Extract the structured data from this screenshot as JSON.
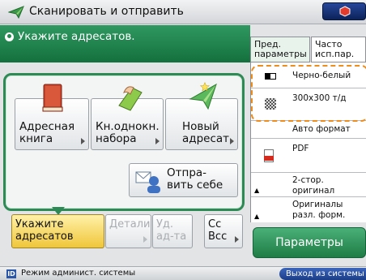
{
  "title_bar": {
    "title": "Сканировать и отправить"
  },
  "instruction": {
    "text": "Укажите адресатов."
  },
  "top_tabs": {
    "preferred": "Пред.\nпараметры",
    "frequent": "Часто\nисп.пар."
  },
  "settings": [
    {
      "label": "Черно-белый",
      "icon": "black-white-icon"
    },
    {
      "label": "300x300 т/д",
      "icon": "resolution-icon"
    },
    {
      "label": "Авто формат",
      "icon": "none"
    },
    {
      "label": "PDF",
      "icon": "pdf-icon"
    },
    {
      "label": "2-стор.\nоригинал",
      "icon": "none"
    },
    {
      "label": "Оригиналы\nразл. форм.",
      "icon": "none"
    }
  ],
  "main_buttons": {
    "address_book": "Адресная\nкнига",
    "one_touch": "Кн.однокн.\nнабора",
    "new_dest": "Новый\nадресат",
    "send_self": "Отпра-\nвить себе"
  },
  "bottom_buttons": {
    "specify": "Укажите\nадресатов",
    "details": "Детали",
    "delete": "Уд.\nад-та",
    "cc_bcc": "Cc\nBcc"
  },
  "params_button": "Параметры",
  "status": {
    "text": "Режим админист. системы",
    "logout": "Выход из системы",
    "badge": "ID"
  },
  "colors": {
    "accent_green": "#22894f",
    "highlight_yellow": "#f0c63a",
    "dash_orange": "#f08c1c",
    "logout_blue": "#1b3d86"
  }
}
